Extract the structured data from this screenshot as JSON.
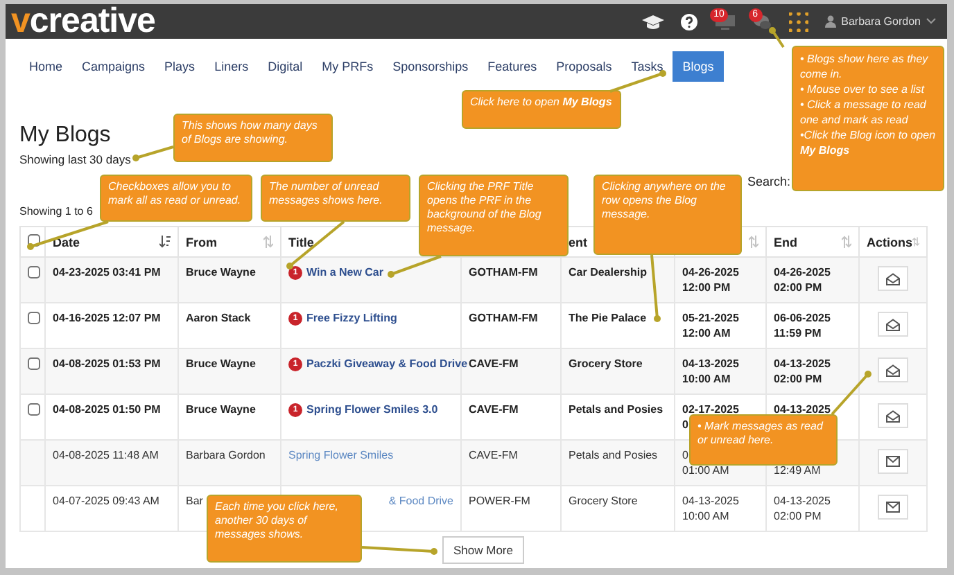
{
  "top_bar": {
    "logo_first": "v",
    "logo_rest": "creative",
    "notifications": [
      {
        "kind": "screen",
        "badge": "10"
      },
      {
        "kind": "blog",
        "badge": "6"
      }
    ],
    "user": "Barbara Gordon"
  },
  "nav": [
    {
      "label": "Home",
      "selected": false
    },
    {
      "label": "Campaigns",
      "selected": false
    },
    {
      "label": "Plays",
      "selected": false
    },
    {
      "label": "Liners",
      "selected": false
    },
    {
      "label": "Digital",
      "selected": false
    },
    {
      "label": "My PRFs",
      "selected": false
    },
    {
      "label": "Sponsorships",
      "selected": false
    },
    {
      "label": "Features",
      "selected": false
    },
    {
      "label": "Proposals",
      "selected": false
    },
    {
      "label": "Tasks",
      "selected": false
    },
    {
      "label": "Blogs",
      "selected": true
    }
  ],
  "page_title": "My Blogs",
  "range_note": "Showing last 30 days",
  "search_label": "Search:",
  "showing_note": "Showing 1 to 6",
  "table": {
    "header_checkbox": {
      "checked": false
    },
    "columns": [
      {
        "label": "Date",
        "sorted": true
      },
      {
        "label": "From",
        "sorted": false
      },
      {
        "label": "Title"
      },
      {},
      {
        "label": "ent"
      },
      {
        "sorted": false
      },
      {
        "label": "End",
        "sorted": false
      },
      {
        "label": "Actions",
        "sorted": false
      }
    ],
    "rows": [
      {
        "checked": false,
        "unread": true,
        "badge": "1",
        "date": "04-23-2025 03:41 PM",
        "from": "Bruce Wayne",
        "title": "Win a New Car",
        "station": "GOTHAM-FM",
        "client": "Car Dealership",
        "start": {
          "date": "04-26-2025",
          "time": "12:00 PM"
        },
        "end": {
          "date": "04-26-2025",
          "time": "02:00 PM"
        }
      },
      {
        "checked": false,
        "unread": true,
        "badge": "1",
        "date": "04-16-2025 12:07 PM",
        "from": "Aaron Stack",
        "title": "Free Fizzy Lifting",
        "station": "GOTHAM-FM",
        "client": "The Pie Palace",
        "start": {
          "date": "05-21-2025",
          "time": "12:00 AM"
        },
        "end": {
          "date": "06-06-2025",
          "time": "11:59 PM"
        }
      },
      {
        "checked": false,
        "unread": true,
        "badge": "1",
        "date": "04-08-2025 01:53 PM",
        "from": "Bruce Wayne",
        "title": "Paczki Giveaway & Food Drive",
        "station": "CAVE-FM",
        "client": "Grocery Store",
        "start": {
          "date": "04-13-2025",
          "time": "10:00 AM"
        },
        "end": {
          "date": "04-13-2025",
          "time": "02:00 PM"
        }
      },
      {
        "checked": false,
        "unread": true,
        "badge": "1",
        "date": "04-08-2025 01:50 PM",
        "from": "Bruce Wayne",
        "title": "Spring Flower Smiles 3.0",
        "station": "CAVE-FM",
        "client": "Petals and Posies",
        "start": {
          "date": "02-17-2025",
          "time": "0"
        },
        "end": {
          "date": "04-13-2025"
        }
      },
      {
        "unread": false,
        "date": "04-08-2025 11:48 AM",
        "from": "Barbara Gordon",
        "title": "Spring Flower Smiles",
        "station": "CAVE-FM",
        "client": "Petals and Posies",
        "start": {
          "date": "0",
          "time": "01:00 AM"
        },
        "end": {
          "time": "12:49 AM"
        }
      },
      {
        "unread": false,
        "title_covered": true,
        "date": "04-07-2025 09:43 AM",
        "from": "Bar",
        "title": "& Food Drive",
        "station": "POWER-FM",
        "client": "Grocery Store",
        "start": {
          "date": "04-13-2025",
          "time": "10:00 AM"
        },
        "end": {
          "date": "04-13-2025",
          "time": "02:00 PM"
        }
      }
    ]
  },
  "show_more": "Show More",
  "callouts": [
    {
      "lines": [
        "Click here to open **My Blogs**"
      ]
    },
    {
      "lines": [
        "• Blogs show here as they come in.",
        "• Mouse over to see a list",
        "• Click a message to read one and mark as read",
        "•Click the Blog icon to open **My Blogs**"
      ]
    },
    {
      "lines": [
        "This shows how many days of Blogs are showing."
      ]
    },
    {
      "lines": [
        "Checkboxes allow you to mark all as read or unread."
      ]
    },
    {
      "lines": [
        "The number of unread messages shows here."
      ]
    },
    {
      "lines": [
        "Clicking the PRF Title opens the PRF in the background of the Blog message."
      ]
    },
    {
      "lines": [
        "Clicking anywhere on the row opens the Blog message."
      ]
    },
    {
      "lines": [
        "• Mark messages as read or unread here."
      ]
    },
    {
      "lines": [
        "Each time you  click here, another 30 days of messages shows."
      ]
    }
  ]
}
